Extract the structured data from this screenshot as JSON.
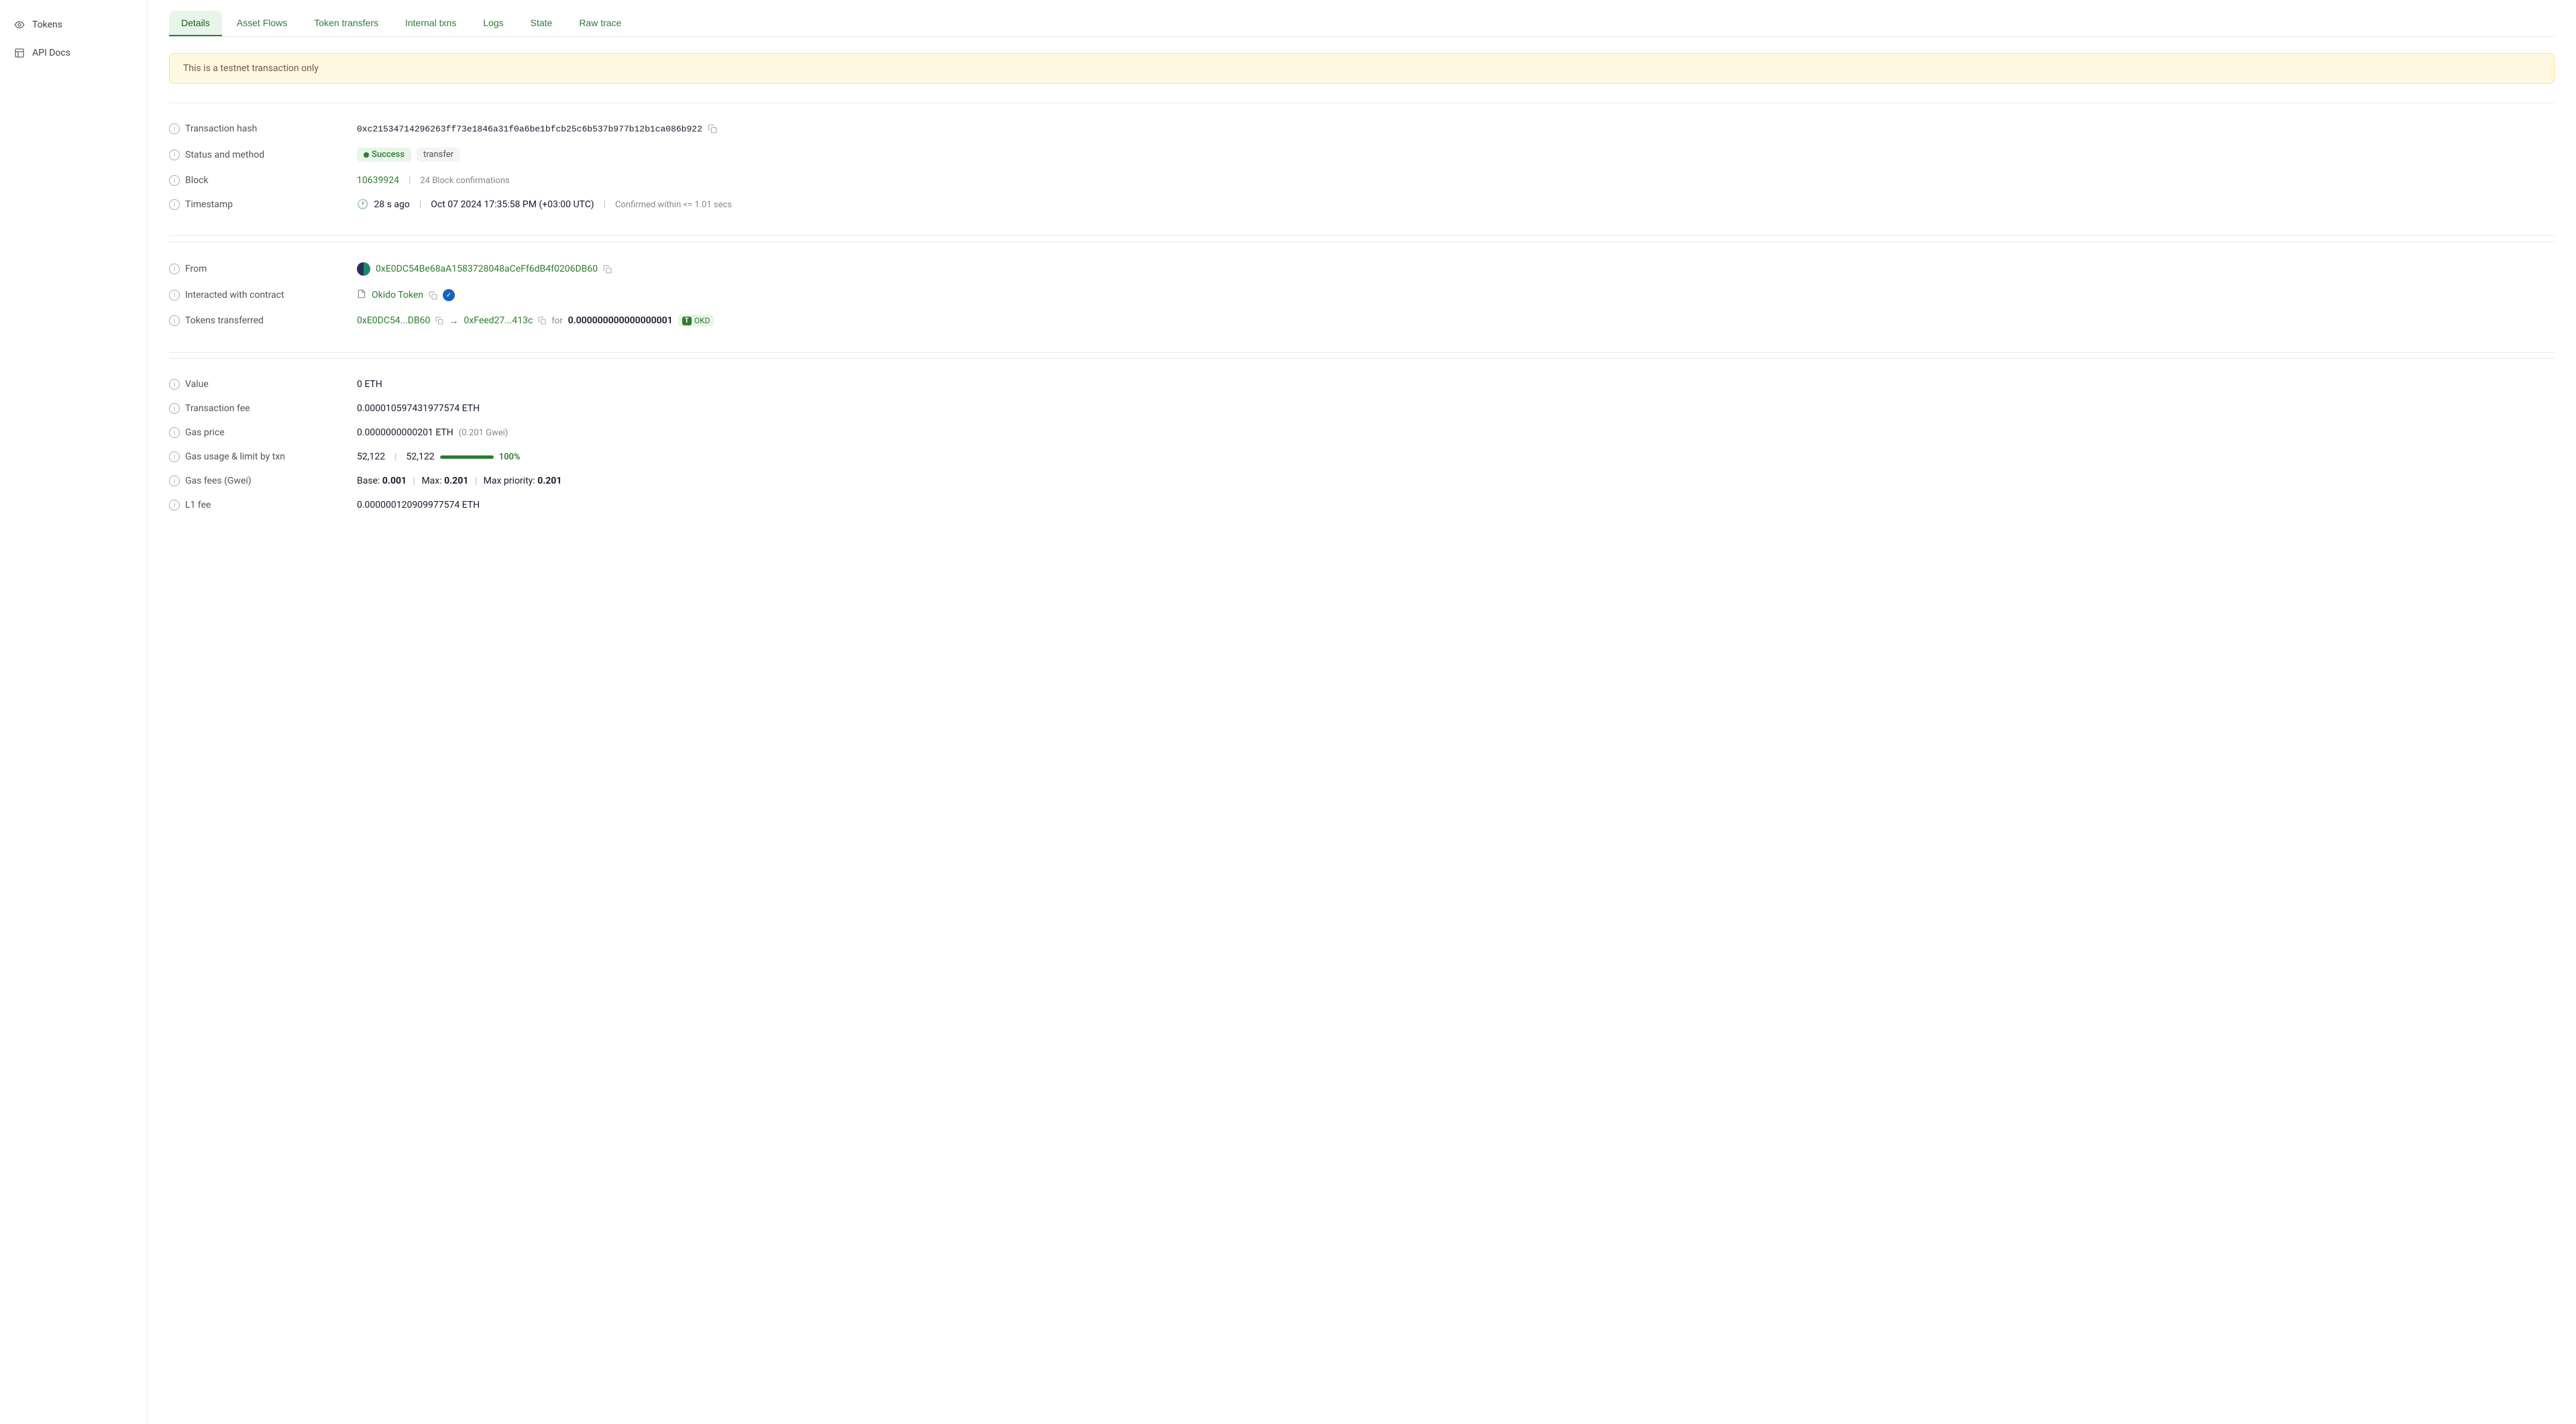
{
  "sidebar": {
    "items": [
      {
        "id": "tokens",
        "label": "Tokens",
        "icon": "eye-icon"
      },
      {
        "id": "api-docs",
        "label": "API Docs",
        "icon": "api-icon"
      }
    ]
  },
  "tabs": [
    {
      "id": "details",
      "label": "Details",
      "active": true
    },
    {
      "id": "asset-flows",
      "label": "Asset Flows",
      "active": false
    },
    {
      "id": "token-transfers",
      "label": "Token transfers",
      "active": false
    },
    {
      "id": "internal-txns",
      "label": "Internal txns",
      "active": false
    },
    {
      "id": "logs",
      "label": "Logs",
      "active": false
    },
    {
      "id": "state",
      "label": "State",
      "active": false
    },
    {
      "id": "raw-trace",
      "label": "Raw trace",
      "active": false
    }
  ],
  "alert": {
    "message": "This is a testnet transaction only"
  },
  "transaction": {
    "hash": {
      "label": "Transaction hash",
      "value": "0xc21534714296263ff73e1846a31f0a6be1bfcb25c6b537b977b12b1ca086b922"
    },
    "status": {
      "label": "Status and method",
      "status_text": "Success",
      "method_text": "transfer"
    },
    "block": {
      "label": "Block",
      "block_number": "10639924",
      "confirmations": "24 Block confirmations"
    },
    "timestamp": {
      "label": "Timestamp",
      "ago": "28 s ago",
      "datetime": "Oct 07 2024 17:35:58 PM (+03:00 UTC)",
      "confirmed": "Confirmed within <= 1.01 secs"
    },
    "from": {
      "label": "From",
      "address": "0xE0DC54Be68aA1583728048aCeFf6dB4f0206DB60"
    },
    "contract": {
      "label": "Interacted with contract",
      "name": "Okido Token"
    },
    "tokens_transferred": {
      "label": "Tokens transferred",
      "from_address": "0xE0DC54...DB60",
      "to_address": "0xFeed27...413c",
      "amount": "0.000000000000000001",
      "token_symbol": "OKD"
    },
    "value": {
      "label": "Value",
      "amount": "0 ETH"
    },
    "fee": {
      "label": "Transaction fee",
      "amount": "0.000010597431977574 ETH"
    },
    "gas_price": {
      "label": "Gas price",
      "amount": "0.0000000000201 ETH",
      "gwei": "0.201 Gwei"
    },
    "gas_usage": {
      "label": "Gas usage & limit by txn",
      "used": "52,122",
      "limit": "52,122",
      "percent": "100%"
    },
    "gas_fees": {
      "label": "Gas fees (Gwei)",
      "base": "0.001",
      "max": "0.201",
      "max_priority": "0.201"
    },
    "l1_fee": {
      "label": "L1 fee",
      "amount": "0.000000120909977574 ETH"
    }
  }
}
